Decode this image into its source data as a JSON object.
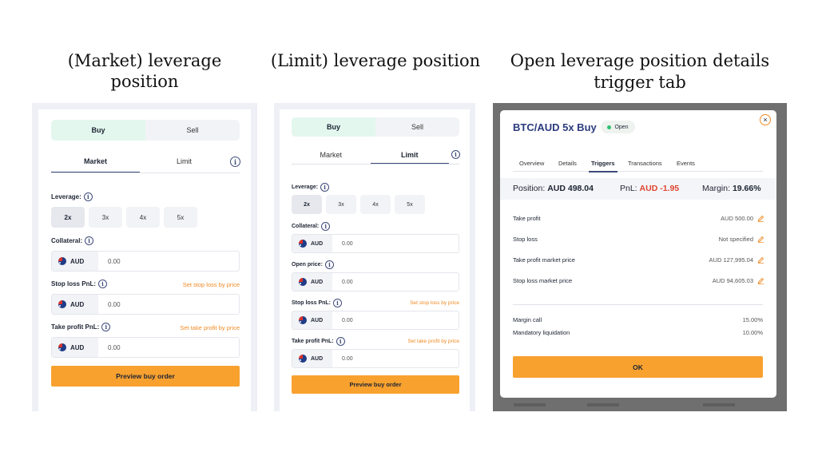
{
  "headings": {
    "market": "(Market) leverage position",
    "limit": "(Limit) leverage position",
    "details_line1": "Open leverage position details",
    "details_line2": "trigger tab"
  },
  "colors": {
    "accent_orange": "#f8a12f",
    "buy_green_bg": "#e3f7ee",
    "navy": "#2b3b7e",
    "negative_red": "#e0442f",
    "open_green": "#2fbf71"
  },
  "market_form": {
    "buy_label": "Buy",
    "sell_label": "Sell",
    "tab_market": "Market",
    "tab_limit": "Limit",
    "leverage_label": "Leverage:",
    "leverage_options": [
      "2x",
      "3x",
      "4x",
      "5x"
    ],
    "selected_leverage": "2x",
    "collateral_label": "Collateral:",
    "collateral": {
      "currency": "AUD",
      "value": "0.00"
    },
    "stop_loss_label": "Stop loss PnL:",
    "stop_loss_link": "Set stop loss by price",
    "stop_loss": {
      "currency": "AUD",
      "value": "0.00"
    },
    "take_profit_label": "Take profit PnL:",
    "take_profit_link": "Set take profit by price",
    "take_profit": {
      "currency": "AUD",
      "value": "0.00"
    },
    "preview_button": "Preview buy order"
  },
  "limit_form": {
    "buy_label": "Buy",
    "sell_label": "Sell",
    "tab_market": "Market",
    "tab_limit": "Limit",
    "leverage_label": "Leverage:",
    "leverage_options": [
      "2x",
      "3x",
      "4x",
      "5x"
    ],
    "selected_leverage": "2x",
    "collateral_label": "Collateral:",
    "collateral": {
      "currency": "AUD",
      "value": "0.00"
    },
    "open_price_label": "Open price:",
    "open_price": {
      "currency": "AUD",
      "value": "0.00"
    },
    "stop_loss_label": "Stop loss PnL:",
    "stop_loss_link": "Set stop loss by price",
    "stop_loss": {
      "currency": "AUD",
      "value": "0.00"
    },
    "take_profit_label": "Take profit PnL:",
    "take_profit_link": "Set take profit by price",
    "take_profit": {
      "currency": "AUD",
      "value": "0.00"
    },
    "preview_button": "Preview buy order"
  },
  "details_modal": {
    "title": "BTC/AUD 5x Buy",
    "status": "Open",
    "tabs": [
      "Overview",
      "Details",
      "Triggers",
      "Transactions",
      "Events"
    ],
    "active_tab": "Triggers",
    "position_label": "Position:",
    "position_value": "AUD 498.04",
    "pnl_label": "PnL:",
    "pnl_value": "AUD -1.95",
    "margin_label": "Margin:",
    "margin_value": "19.66%",
    "triggers": [
      {
        "label": "Take profit",
        "value": "AUD 500.00"
      },
      {
        "label": "Stop loss",
        "value": "Not specified"
      },
      {
        "label": "Take profit market price",
        "value": "AUD 127,995.04"
      },
      {
        "label": "Stop loss market price",
        "value": "AUD 94,605.03"
      }
    ],
    "margin_call_label": "Margin call",
    "margin_call_value": "15.00%",
    "liquidation_label": "Mandatory liquidation",
    "liquidation_value": "10.00%",
    "ok_button": "OK"
  }
}
